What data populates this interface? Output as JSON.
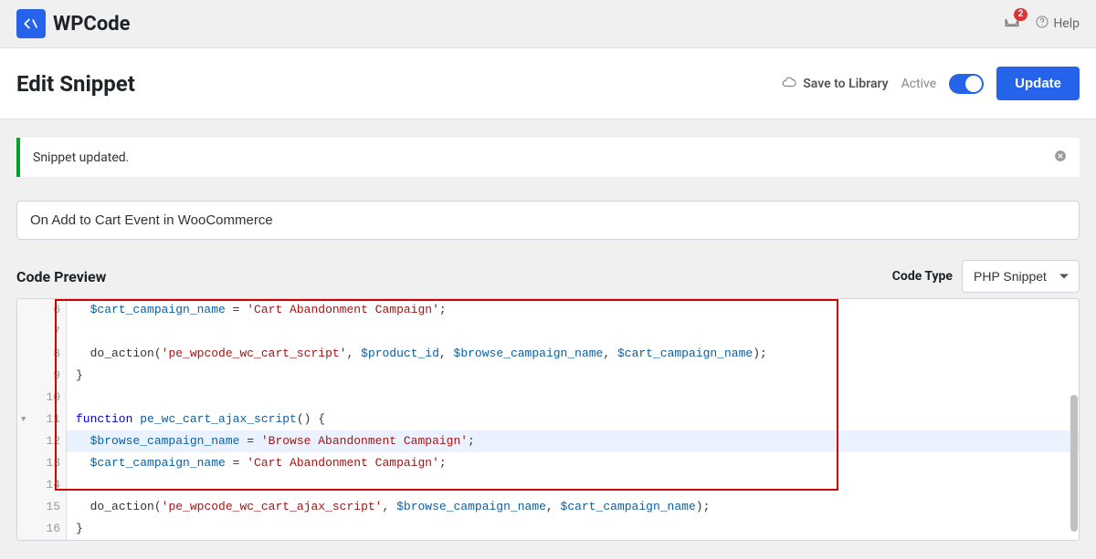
{
  "brand": {
    "name": "WPCode"
  },
  "top": {
    "notif_count": "2",
    "help": "Help"
  },
  "header": {
    "title": "Edit Snippet",
    "save_library": "Save to Library",
    "active": "Active",
    "update": "Update"
  },
  "notice": {
    "text": "Snippet updated."
  },
  "snippet_title": "On Add to Cart Event in WooCommerce",
  "section": {
    "preview": "Code Preview",
    "codetype_label": "Code Type",
    "codetype_value": "PHP Snippet"
  },
  "code": {
    "lines": [
      {
        "n": 6,
        "indent": "  ",
        "tokens": [
          [
            "var",
            "$cart_campaign_name"
          ],
          [
            "op",
            " = "
          ],
          [
            "str",
            "'Cart Abandonment Campaign'"
          ],
          [
            "p",
            ";"
          ]
        ]
      },
      {
        "n": 7,
        "indent": "",
        "tokens": []
      },
      {
        "n": 8,
        "indent": "  ",
        "tokens": [
          [
            "call",
            "do_action"
          ],
          [
            "p",
            "("
          ],
          [
            "str",
            "'pe_wpcode_wc_cart_script'"
          ],
          [
            "p",
            ", "
          ],
          [
            "var",
            "$product_id"
          ],
          [
            "p",
            ", "
          ],
          [
            "var",
            "$browse_campaign_name"
          ],
          [
            "p",
            ", "
          ],
          [
            "var",
            "$cart_campaign_name"
          ],
          [
            "p",
            ");"
          ]
        ]
      },
      {
        "n": 9,
        "indent": "",
        "tokens": [
          [
            "p",
            "}"
          ]
        ]
      },
      {
        "n": 10,
        "indent": "",
        "tokens": []
      },
      {
        "n": 11,
        "fold": true,
        "indent": "",
        "tokens": [
          [
            "kw",
            "function"
          ],
          [
            "p",
            " "
          ],
          [
            "fn",
            "pe_wc_cart_ajax_script"
          ],
          [
            "p",
            "() {"
          ]
        ]
      },
      {
        "n": 12,
        "active": true,
        "indent": "  ",
        "tokens": [
          [
            "var",
            "$browse_campaign_name"
          ],
          [
            "op",
            " = "
          ],
          [
            "str",
            "'Browse Abandonment Campaign'"
          ],
          [
            "p",
            ";"
          ]
        ]
      },
      {
        "n": 13,
        "indent": "  ",
        "tokens": [
          [
            "var",
            "$cart_campaign_name"
          ],
          [
            "op",
            " = "
          ],
          [
            "str",
            "'Cart Abandonment Campaign'"
          ],
          [
            "p",
            ";"
          ]
        ]
      },
      {
        "n": 14,
        "indent": "",
        "tokens": []
      },
      {
        "n": 15,
        "indent": "  ",
        "tokens": [
          [
            "call",
            "do_action"
          ],
          [
            "p",
            "("
          ],
          [
            "str",
            "'pe_wpcode_wc_cart_ajax_script'"
          ],
          [
            "p",
            ", "
          ],
          [
            "var",
            "$browse_campaign_name"
          ],
          [
            "p",
            ", "
          ],
          [
            "var",
            "$cart_campaign_name"
          ],
          [
            "p",
            ");"
          ]
        ]
      },
      {
        "n": 16,
        "indent": "",
        "tokens": [
          [
            "p",
            "}"
          ]
        ]
      }
    ]
  }
}
